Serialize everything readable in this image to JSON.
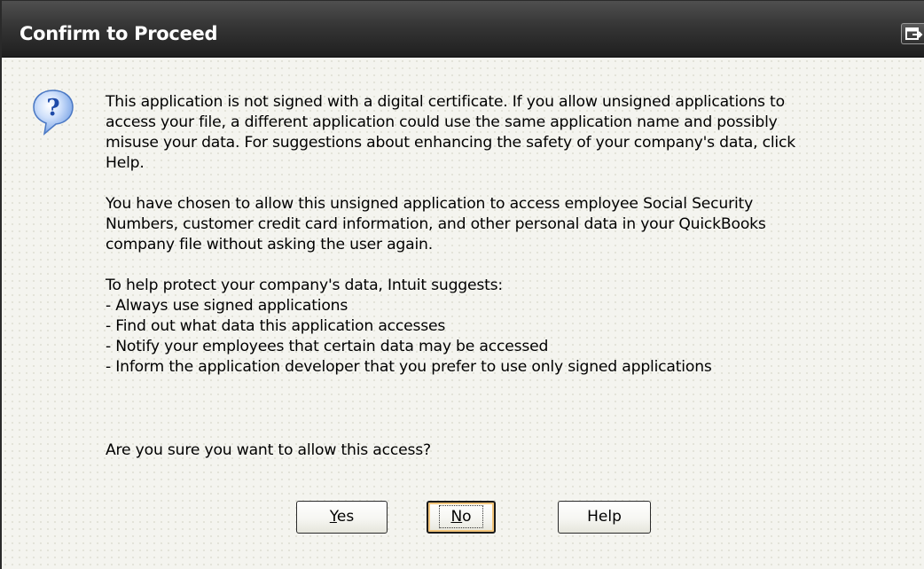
{
  "dialog": {
    "title": "Confirm to Proceed",
    "icon": "question-icon"
  },
  "message": {
    "paragraph1": [
      "This application is not signed with a digital certificate.  If you allow unsigned applications to",
      "access your file, a different application could use the same application name and possibly",
      "misuse your data.  For suggestions about enhancing the safety of your company's data, click",
      "Help."
    ],
    "paragraph2": [
      "You have chosen to allow this unsigned application to access employee Social Security",
      "Numbers, customer credit card information, and other personal data in your QuickBooks",
      "company file without asking the user again."
    ],
    "paragraph3_intro": "To help protect your company's data, Intuit suggests:",
    "suggestions": [
      "-  Always use signed applications",
      "-  Find out what data this application accesses",
      "-  Notify your employees that certain data may be accessed",
      "-  Inform the application developer that you prefer to use only signed applications"
    ],
    "question": "Are you sure you want to allow this access?"
  },
  "buttons": {
    "yes_mnemonic": "Y",
    "yes_rest": "es",
    "no_mnemonic": "N",
    "no_rest": "o",
    "help_label": "Help"
  },
  "colors": {
    "titlebar": "#353535",
    "background": "#f4f4ef",
    "focus_highlight": "#f3c57a",
    "icon_blue": "#2a6fd6"
  }
}
